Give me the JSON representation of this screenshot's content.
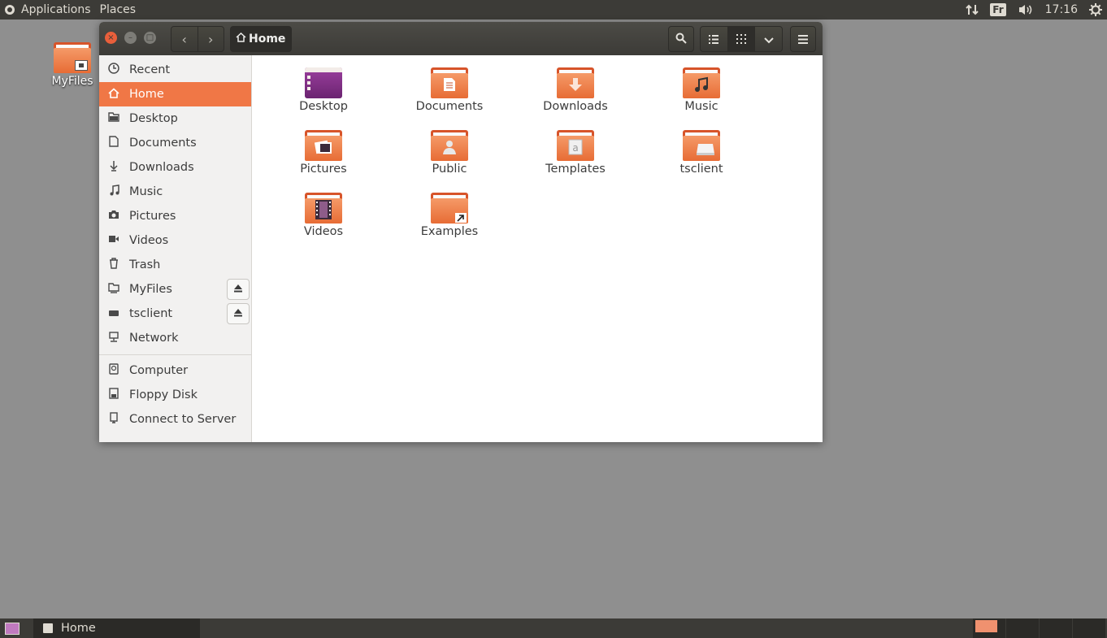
{
  "top_panel": {
    "applications_label": "Applications",
    "places_label": "Places",
    "keyboard_layout": "Fr",
    "clock": "17:16"
  },
  "desktop": {
    "icons": [
      {
        "label": "MyFiles"
      }
    ]
  },
  "window": {
    "path_label": "Home",
    "buttons": {
      "back": "‹",
      "forward": "›",
      "close": "×",
      "minimize": "–",
      "maximize": "□"
    },
    "view_active": "grid"
  },
  "sidebar": {
    "items": [
      {
        "label": "Recent",
        "icon": "recent-icon"
      },
      {
        "label": "Home",
        "icon": "home-icon",
        "selected": true
      },
      {
        "label": "Desktop",
        "icon": "desktop-folder-icon"
      },
      {
        "label": "Documents",
        "icon": "document-icon"
      },
      {
        "label": "Downloads",
        "icon": "download-icon"
      },
      {
        "label": "Music",
        "icon": "music-icon"
      },
      {
        "label": "Pictures",
        "icon": "camera-icon"
      },
      {
        "label": "Videos",
        "icon": "video-icon"
      },
      {
        "label": "Trash",
        "icon": "trash-icon"
      },
      {
        "label": "MyFiles",
        "icon": "folder-network-icon",
        "eject": true
      },
      {
        "label": "tsclient",
        "icon": "drive-icon",
        "eject": true
      },
      {
        "label": "Network",
        "icon": "network-icon"
      }
    ],
    "devices": [
      {
        "label": "Computer",
        "icon": "computer-icon"
      },
      {
        "label": "Floppy Disk",
        "icon": "floppy-icon"
      },
      {
        "label": "Connect to Server",
        "icon": "server-icon"
      }
    ]
  },
  "content": {
    "files": [
      {
        "label": "Desktop",
        "icon": "desktop-folder-icon"
      },
      {
        "label": "Documents",
        "icon": "documents-folder-icon"
      },
      {
        "label": "Downloads",
        "icon": "downloads-folder-icon"
      },
      {
        "label": "Music",
        "icon": "music-folder-icon"
      },
      {
        "label": "Pictures",
        "icon": "pictures-folder-icon"
      },
      {
        "label": "Public",
        "icon": "public-folder-icon"
      },
      {
        "label": "Templates",
        "icon": "templates-folder-icon"
      },
      {
        "label": "tsclient",
        "icon": "tsclient-folder-icon"
      },
      {
        "label": "Videos",
        "icon": "videos-folder-icon"
      },
      {
        "label": "Examples",
        "icon": "examples-folder-icon"
      }
    ]
  },
  "taskbar": {
    "window_label": "Home"
  },
  "colors": {
    "accent": "#f07746",
    "panel": "#3c3b37",
    "desktop": "#8f8f8f",
    "folder": "#e76c35"
  }
}
